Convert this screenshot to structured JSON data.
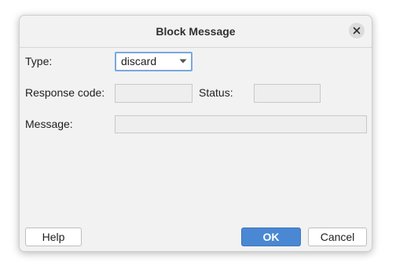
{
  "dialog": {
    "title": "Block Message"
  },
  "form": {
    "type_label": "Type:",
    "type_value": "discard",
    "response_code_label": "Response code:",
    "response_code_value": "",
    "status_label": "Status:",
    "status_value": "",
    "message_label": "Message:",
    "message_value": ""
  },
  "buttons": {
    "help": "Help",
    "ok": "OK",
    "cancel": "Cancel"
  },
  "icons": {
    "close": "close-icon",
    "dropdown": "chevron-down-icon"
  },
  "colors": {
    "accent": "#4a88d3",
    "focus_border": "#7aa7de"
  }
}
